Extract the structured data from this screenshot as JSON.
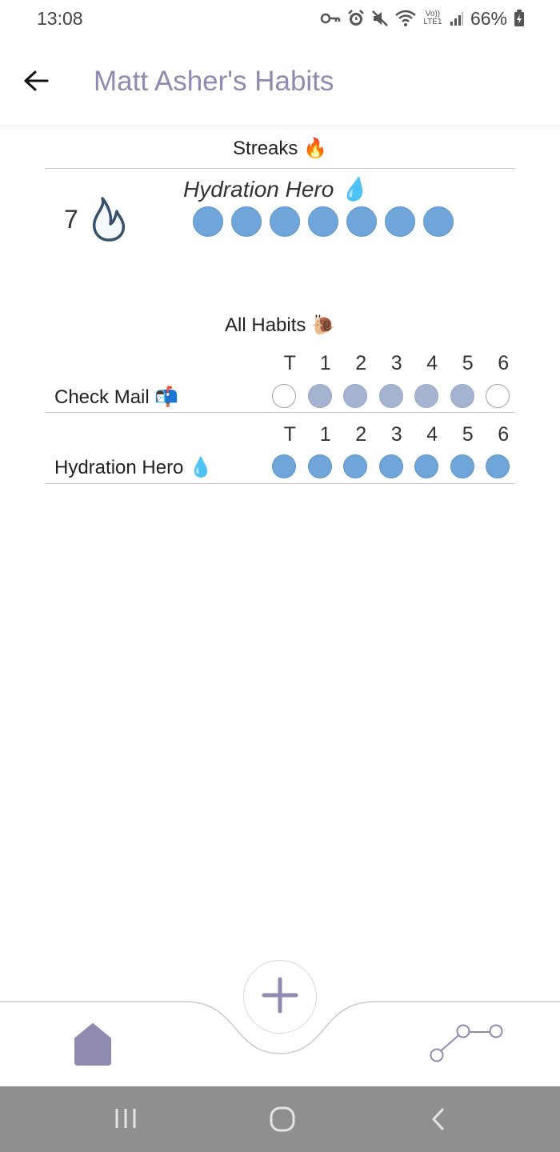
{
  "status_bar": {
    "time": "13:08",
    "battery": "66%",
    "network_label": "Vo)) LTE1",
    "icons": [
      "key-icon",
      "alarm-icon",
      "mute-icon",
      "wifi-icon",
      "signal-icon",
      "battery-icon"
    ]
  },
  "header": {
    "title": "Matt Asher's Habits",
    "back_icon": "arrow-left-icon"
  },
  "streaks": {
    "title": "Streaks 🔥",
    "count": "7",
    "habit_name": "Hydration Hero 💧",
    "filled_days": 7
  },
  "all_habits": {
    "title": "All Habits 🐌",
    "day_labels": [
      "T",
      "1",
      "2",
      "3",
      "4",
      "5",
      "6"
    ],
    "habits": [
      {
        "name": "Check Mail 📬",
        "states": [
          "empty",
          "partial",
          "partial",
          "partial",
          "partial",
          "partial",
          "empty"
        ]
      },
      {
        "name": "Hydration Hero 💧",
        "states": [
          "full",
          "full",
          "full",
          "full",
          "full",
          "full",
          "full"
        ]
      }
    ]
  },
  "bottom_nav": {
    "add_icon": "plus-icon",
    "home_icon": "home-icon",
    "stats_icon": "line-graph-icon"
  },
  "colors": {
    "title": "#8e8ab0",
    "accent": "#8e8ab0",
    "dot_full": "#6fa5d8",
    "dot_partial": "#a4b3d0",
    "system_nav": "#8f8f8f"
  }
}
